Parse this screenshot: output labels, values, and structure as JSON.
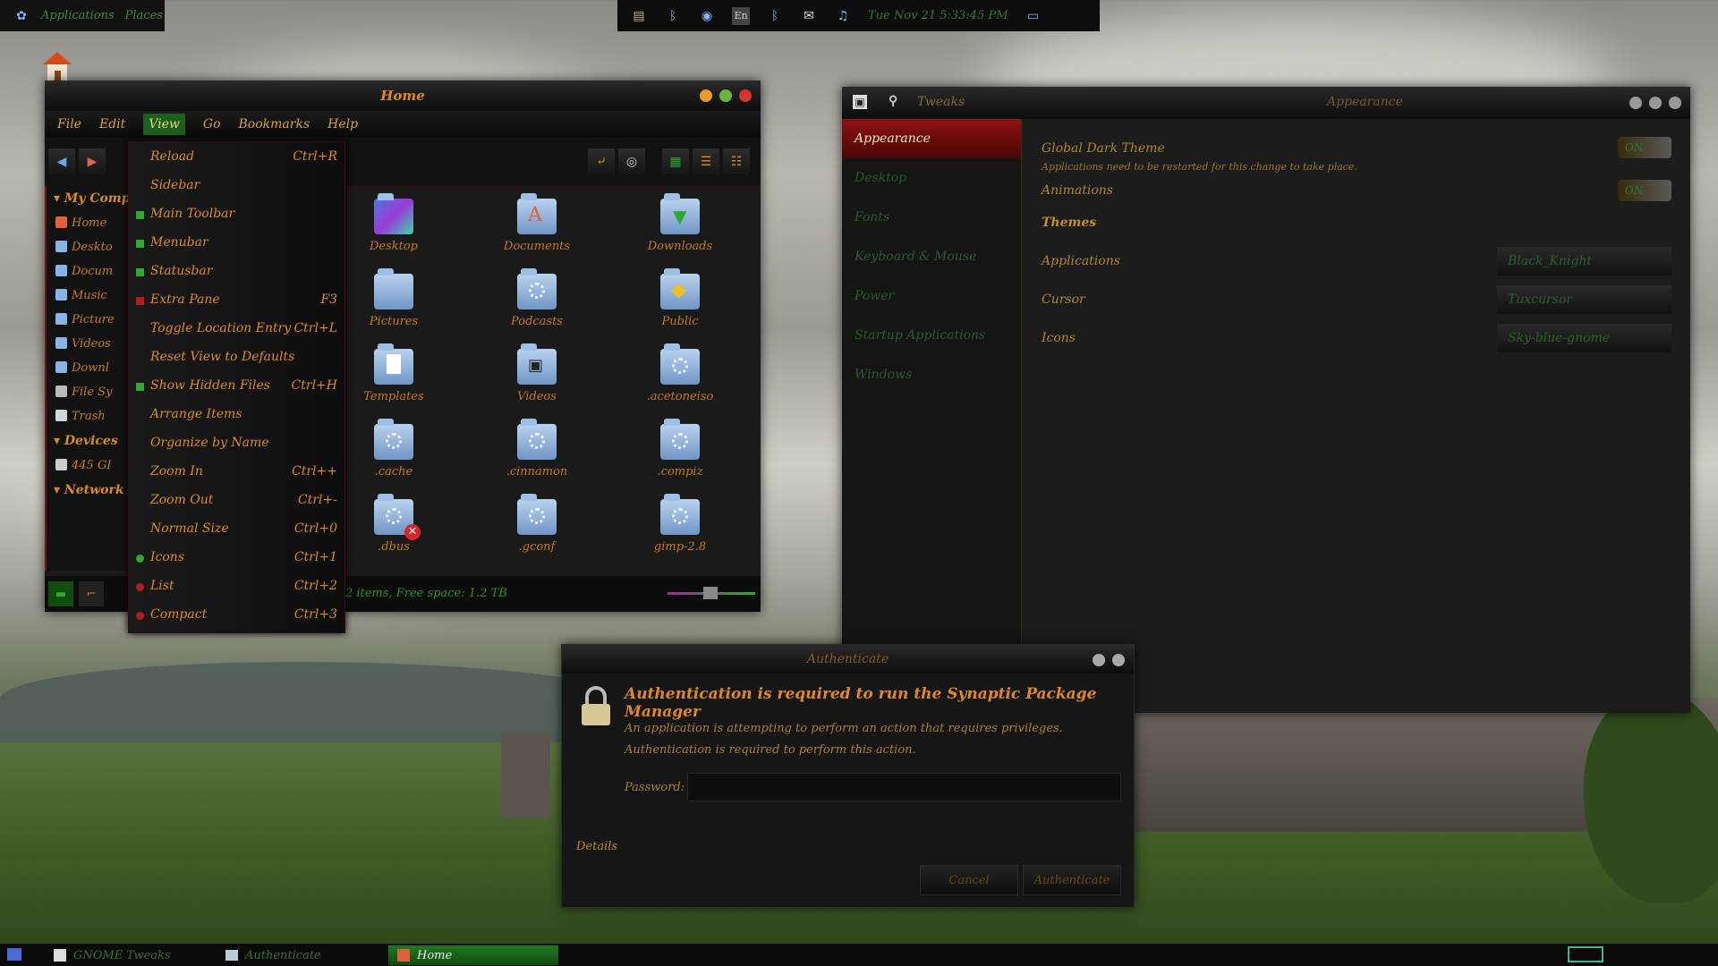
{
  "top_left_panel": {
    "applications": "Applications",
    "places": "Places"
  },
  "top_center_panel": {
    "keyboard_layout": "En",
    "clock": "Tue Nov 21  5:33:45 PM"
  },
  "file_manager": {
    "title": "Home",
    "menu": [
      "File",
      "Edit",
      "View",
      "Go",
      "Bookmarks",
      "Help"
    ],
    "sidebar": {
      "my_computer": "My Comp",
      "places": [
        "Home",
        "Deskto",
        "Docum",
        "Music",
        "Picture",
        "Videos",
        "Downl",
        "File Sy",
        "Trash"
      ],
      "devices": "Devices",
      "device_items": [
        "445 GI"
      ],
      "network": "Network"
    },
    "files": [
      "Desktop",
      "Documents",
      "Downloads",
      "Pictures",
      "Podcasts",
      "Public",
      "Templates",
      "Videos",
      ".acetoneiso",
      ".cache",
      ".cinnamon",
      ".compiz",
      ".dbus",
      ".gconf",
      "gimp-2.8"
    ],
    "status": "2 items, Free space: 1.2 TB"
  },
  "view_menu": [
    {
      "label": "Reload",
      "accel": "Ctrl+R",
      "mark": ""
    },
    {
      "label": "Sidebar",
      "accel": "",
      "mark": ""
    },
    {
      "label": "Main Toolbar",
      "accel": "",
      "mark": "sq-g"
    },
    {
      "label": "Menubar",
      "accel": "",
      "mark": "sq-g"
    },
    {
      "label": "Statusbar",
      "accel": "",
      "mark": "sq-g"
    },
    {
      "label": "Extra Pane",
      "accel": "F3",
      "mark": "sq-r"
    },
    {
      "label": "Toggle Location Entry",
      "accel": "Ctrl+L",
      "mark": ""
    },
    {
      "label": "Reset View to Defaults",
      "accel": "",
      "mark": ""
    },
    {
      "label": "Show Hidden Files",
      "accel": "Ctrl+H",
      "mark": "sq-g"
    },
    {
      "label": "Arrange Items",
      "accel": "",
      "mark": ""
    },
    {
      "label": "Organize by Name",
      "accel": "",
      "mark": ""
    },
    {
      "label": "Zoom In",
      "accel": "Ctrl++",
      "mark": ""
    },
    {
      "label": "Zoom Out",
      "accel": "Ctrl+-",
      "mark": ""
    },
    {
      "label": "Normal Size",
      "accel": "Ctrl+0",
      "mark": ""
    },
    {
      "label": "Icons",
      "accel": "Ctrl+1",
      "mark": "dot-g"
    },
    {
      "label": "List",
      "accel": "Ctrl+2",
      "mark": "dot-r"
    },
    {
      "label": "Compact",
      "accel": "Ctrl+3",
      "mark": "dot-r"
    }
  ],
  "tweaks": {
    "app_name": "Tweaks",
    "title": "Appearance",
    "sidebar": [
      "Appearance",
      "Desktop",
      "Fonts",
      "Keyboard & Mouse",
      "Power",
      "Startup Applications",
      "Windows"
    ],
    "global_dark_theme": "Global Dark Theme",
    "dark_theme_note": "Applications need to be restarted for this change to take place.",
    "animations": "Animations",
    "toggle_on": "ON",
    "themes_header": "Themes",
    "applications_label": "Applications",
    "applications_value": "Black_Knight",
    "cursor_label": "Cursor",
    "cursor_value": "Tuxcursor",
    "icons_label": "Icons",
    "icons_value": "Sky-blue-gnome"
  },
  "auth": {
    "title": "Authenticate",
    "heading": "Authentication is required to run the Synaptic Package Manager",
    "line1": "An application is attempting to perform an action that requires privileges.",
    "line2": "Authentication is required to perform this action.",
    "password_label": "Password:",
    "details": "Details",
    "cancel": "Cancel",
    "authenticate": "Authenticate"
  },
  "taskbar": [
    "GNOME Tweaks",
    "Authenticate",
    "Home"
  ],
  "colors": {
    "accent_orange": "#e08a1a",
    "accent_green": "#2ea82e",
    "accent_red": "#8e1212"
  }
}
